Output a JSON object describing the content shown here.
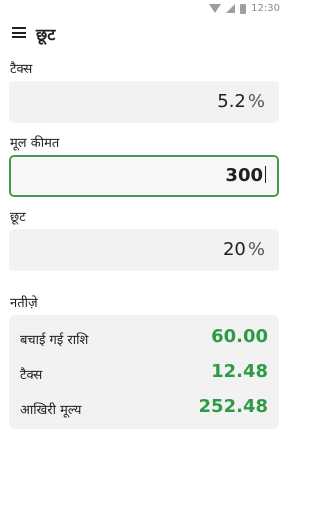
{
  "status_bar": {
    "time": "12:30"
  },
  "app_bar": {
    "title": "छूट"
  },
  "fields": [
    {
      "label": "टैक्स",
      "value": "5.2",
      "unit": "%"
    },
    {
      "label": "मूल कीमत",
      "value": "300",
      "unit": ""
    },
    {
      "label": "छूट",
      "value": "20",
      "unit": "%"
    }
  ],
  "results": {
    "heading": "नतीज़े",
    "rows": [
      {
        "label": "बचाई गई राशि",
        "value": "60.00"
      },
      {
        "label": "टैक्स",
        "value": "12.48"
      },
      {
        "label": "आखिरी मूल्य",
        "value": "252.48"
      }
    ]
  },
  "colors": {
    "accent_green": "#2e9a46",
    "field_bg": "#f2f2f2",
    "border_green": "#3f9d4b"
  }
}
